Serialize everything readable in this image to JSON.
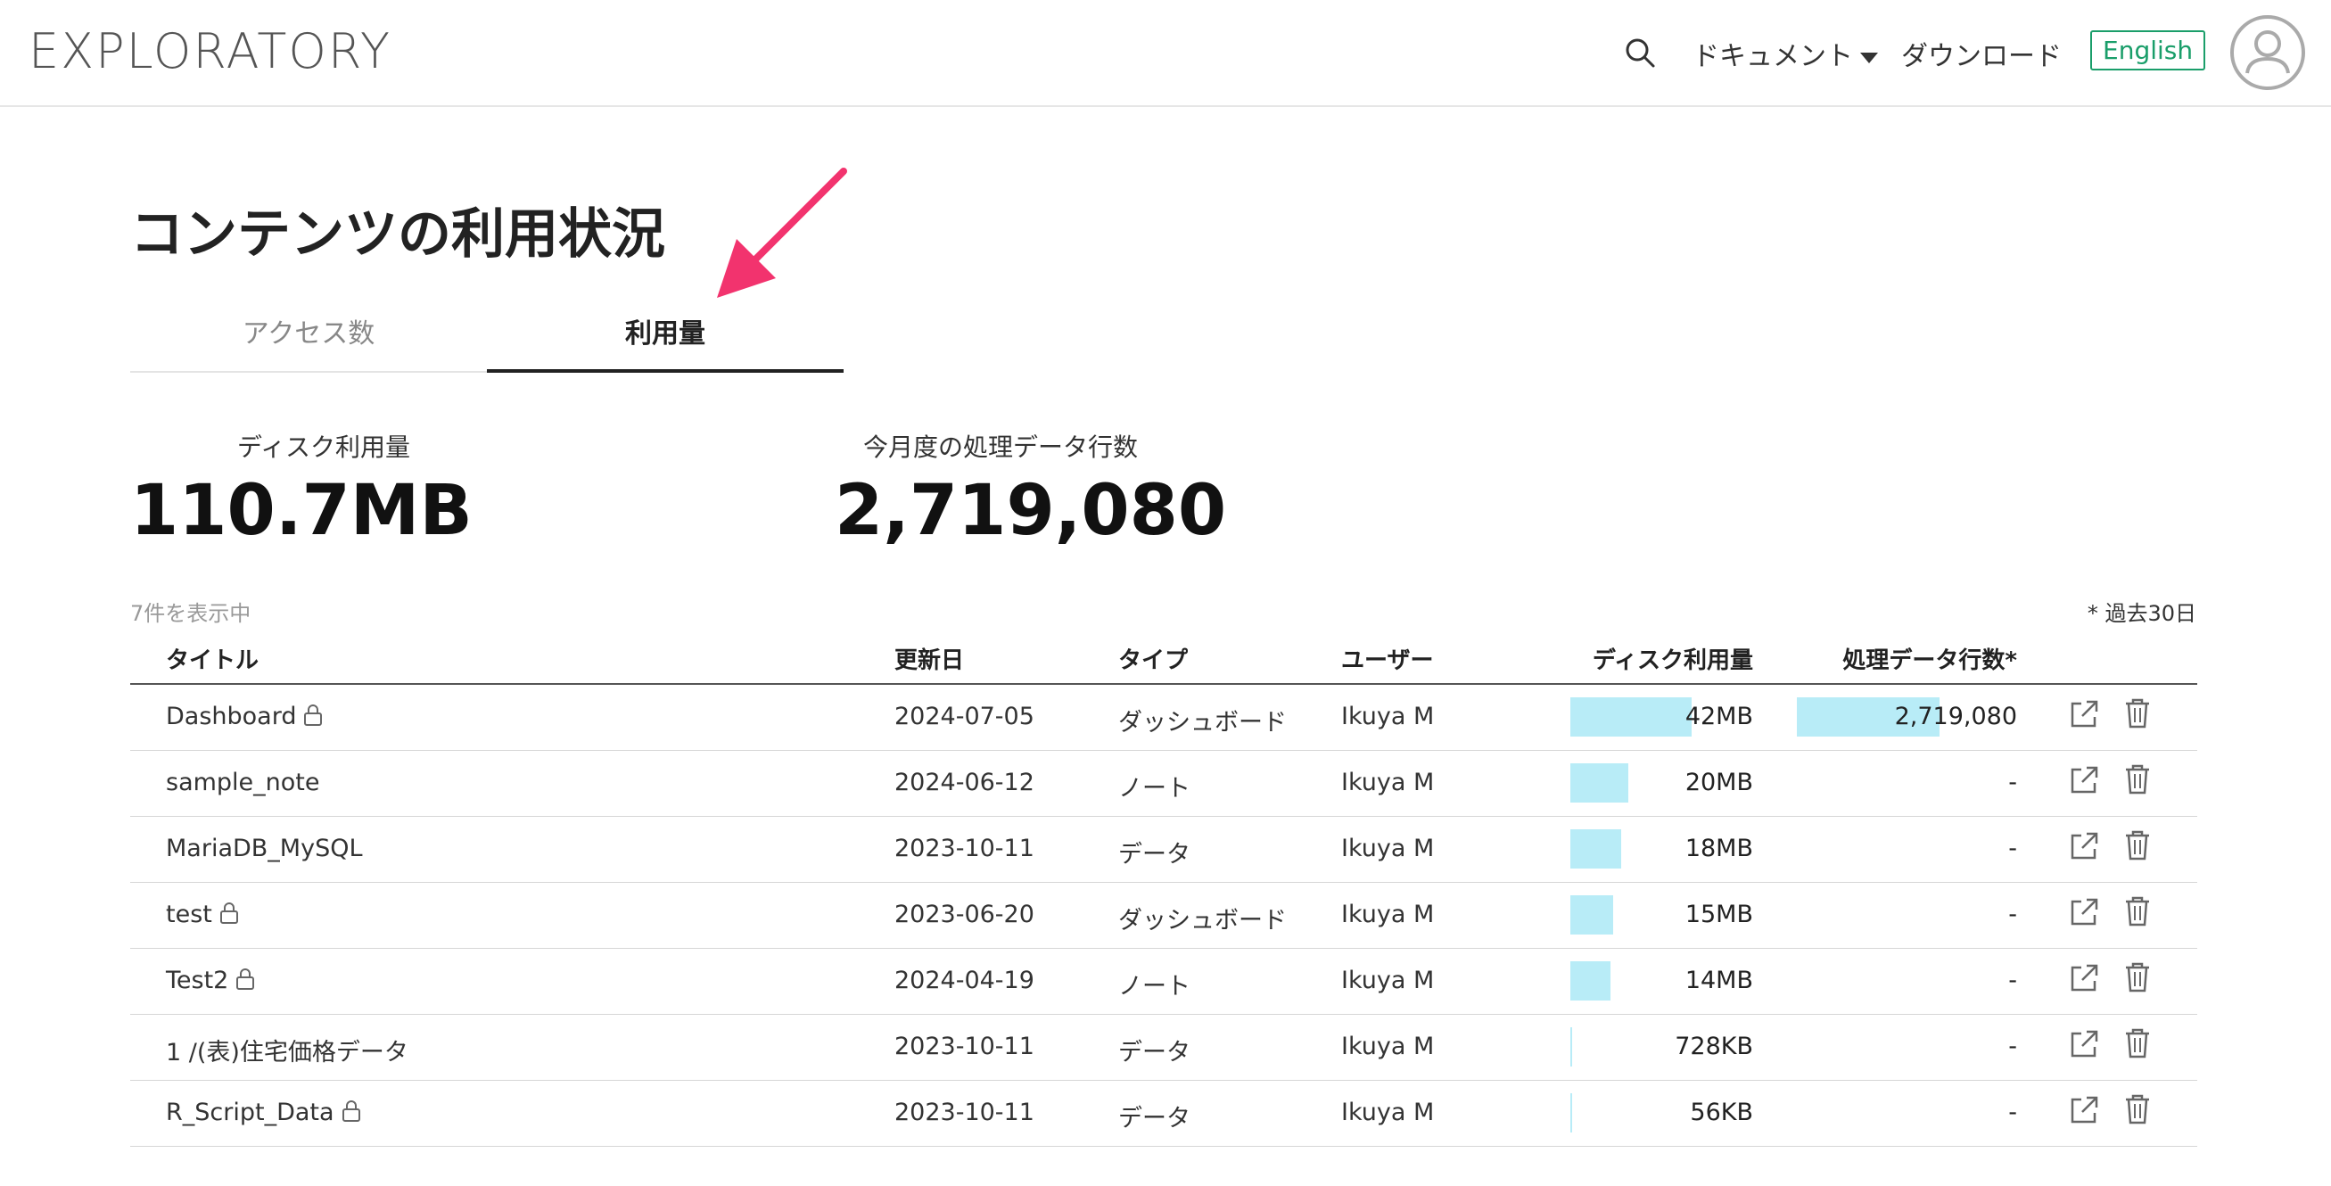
{
  "header": {
    "logo": "EXPLORATORY",
    "docs_label": "ドキュメント",
    "download_label": "ダウンロード",
    "language_label": "English"
  },
  "page": {
    "title": "コンテンツの利用状況",
    "tabs": [
      {
        "label": "アクセス数",
        "active": false
      },
      {
        "label": "利用量",
        "active": true
      }
    ]
  },
  "stats": {
    "disk_label": "ディスク利用量",
    "disk_value": "110.7MB",
    "rows_label": "今月度の処理データ行数",
    "rows_value": "2,719,080"
  },
  "table": {
    "count_label": "7件を表示中",
    "period_label": "* 過去30日",
    "columns": {
      "title": "タイトル",
      "updated": "更新日",
      "type": "タイプ",
      "user": "ユーザー",
      "disk": "ディスク利用量",
      "rows": "処理データ行数*"
    },
    "rows": [
      {
        "title": "Dashboard",
        "locked": true,
        "updated": "2024-07-05",
        "type": "ダッシュボード",
        "user": "Ikuya M",
        "disk": "42MB",
        "disk_ratio": 1.0,
        "rows": "2,719,080",
        "rows_ratio": 1.0
      },
      {
        "title": "sample_note",
        "locked": false,
        "updated": "2024-06-12",
        "type": "ノート",
        "user": "Ikuya M",
        "disk": "20MB",
        "disk_ratio": 0.476,
        "rows": "-",
        "rows_ratio": 0
      },
      {
        "title": "MariaDB_MySQL",
        "locked": false,
        "updated": "2023-10-11",
        "type": "データ",
        "user": "Ikuya M",
        "disk": "18MB",
        "disk_ratio": 0.42,
        "rows": "-",
        "rows_ratio": 0
      },
      {
        "title": "test",
        "locked": true,
        "updated": "2023-06-20",
        "type": "ダッシュボード",
        "user": "Ikuya M",
        "disk": "15MB",
        "disk_ratio": 0.355,
        "rows": "-",
        "rows_ratio": 0
      },
      {
        "title": "Test2",
        "locked": true,
        "updated": "2024-04-19",
        "type": "ノート",
        "user": "Ikuya M",
        "disk": "14MB",
        "disk_ratio": 0.333,
        "rows": "-",
        "rows_ratio": 0
      },
      {
        "title": "1 /(表)住宅価格データ",
        "locked": false,
        "updated": "2023-10-11",
        "type": "データ",
        "user": "Ikuya M",
        "disk": "728KB",
        "disk_ratio": 0.017,
        "rows": "-",
        "rows_ratio": 0
      },
      {
        "title": "R_Script_Data",
        "locked": true,
        "updated": "2023-10-11",
        "type": "データ",
        "user": "Ikuya M",
        "disk": "56KB",
        "disk_ratio": 0.0013,
        "rows": "-",
        "rows_ratio": 0
      }
    ]
  },
  "icons": {
    "search": "search-icon",
    "avatar": "user-avatar-icon",
    "lock": "lock-icon",
    "open": "external-link-icon",
    "delete": "trash-icon",
    "annotation": "pink-arrow"
  },
  "colors": {
    "accent_green": "#1a9e6a",
    "bar_fill": "#b8ecf7",
    "arrow_pink": "#f2336e"
  }
}
